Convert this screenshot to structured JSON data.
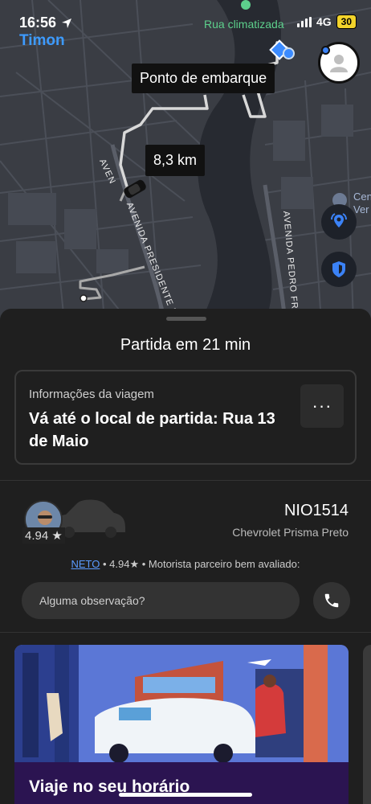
{
  "status_bar": {
    "time": "16:56",
    "network": "4G",
    "battery": "30",
    "back_app": "Timon"
  },
  "map": {
    "place_label": "Rua climatizada",
    "pickup_tooltip": "Ponto de embarque",
    "distance_tooltip": "8,3 km",
    "road_labels": {
      "avenida_presidente": "AVENIDA PRESIDENTE MÉ",
      "aven_short": "AVEN",
      "avenida_pedro": "AVENIDA PEDRO FRE"
    },
    "poi_label": "Cen Ver"
  },
  "sheet": {
    "title": "Partida em 21 min",
    "trip_card": {
      "label": "Informações da viagem",
      "text": "Vá até o local de partida: Rua 13 de Maio",
      "more_label": "···"
    },
    "driver": {
      "rating_chip": "4.94 ★",
      "plate": "NIO1514",
      "car_model": "Chevrolet Prisma Preto",
      "name": "NETO",
      "line_rest": " • 4.94★ • Motorista parceiro bem avaliado:"
    },
    "note_placeholder": "Alguma observação?",
    "promo": {
      "title": "Viaje no seu horário"
    }
  }
}
